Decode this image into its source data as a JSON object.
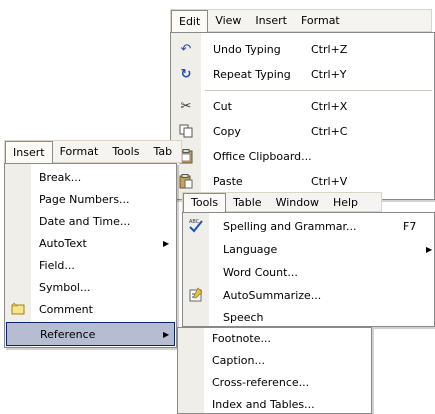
{
  "edit_menu": {
    "bar": [
      "Edit",
      "View",
      "Insert",
      "Format"
    ],
    "items": [
      {
        "label": "Undo Typing",
        "shortcut": "Ctrl+Z",
        "icon": "undo-icon"
      },
      {
        "label": "Repeat Typing",
        "shortcut": "Ctrl+Y",
        "icon": "repeat-icon"
      },
      {
        "label": "Cut",
        "shortcut": "Ctrl+X",
        "icon": "cut-icon"
      },
      {
        "label": "Copy",
        "shortcut": "Ctrl+C",
        "icon": "copy-icon"
      },
      {
        "label": "Office Clipboard...",
        "shortcut": "",
        "icon": "clipboard-icon"
      },
      {
        "label": "Paste",
        "shortcut": "Ctrl+V",
        "icon": "paste-icon"
      }
    ]
  },
  "insert_menu": {
    "bar": [
      "Insert",
      "Format",
      "Tools",
      "Tab"
    ],
    "items": [
      {
        "label": "Break...",
        "submenu": false
      },
      {
        "label": "Page Numbers...",
        "submenu": false
      },
      {
        "label": "Date and Time...",
        "submenu": false
      },
      {
        "label": "AutoText",
        "submenu": true
      },
      {
        "label": "Field...",
        "submenu": false
      },
      {
        "label": "Symbol...",
        "submenu": false
      },
      {
        "label": "Comment",
        "submenu": false,
        "icon": "comment-icon"
      },
      {
        "label": "Reference",
        "submenu": true,
        "highlighted": true
      }
    ]
  },
  "tools_menu": {
    "bar": [
      "Tools",
      "Table",
      "Window",
      "Help"
    ],
    "items": [
      {
        "label": "Spelling and Grammar...",
        "shortcut": "F7",
        "icon": "spelling-icon"
      },
      {
        "label": "Language",
        "submenu": true
      },
      {
        "label": "Word Count...",
        "submenu": false
      },
      {
        "label": "AutoSummarize...",
        "submenu": false,
        "icon": "autosummarize-icon"
      },
      {
        "label": "Speech",
        "submenu": false
      }
    ]
  },
  "reference_submenu": {
    "items": [
      "Footnote...",
      "Caption...",
      "Cross-reference...",
      "Index and Tables..."
    ]
  },
  "colors": {
    "highlight": "#b6bdd2",
    "highlight_border": "#0a246a",
    "icon_blue": "#1f4fb3"
  }
}
